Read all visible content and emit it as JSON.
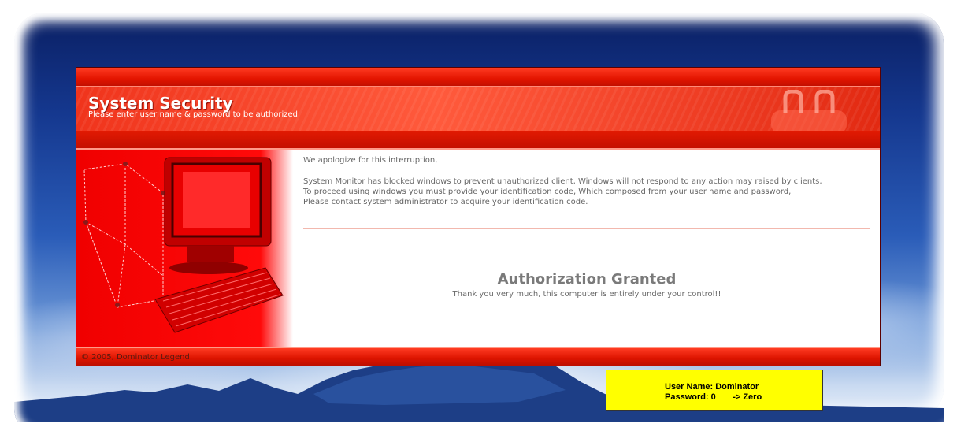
{
  "dialog": {
    "title": "System Security",
    "subtitle": "Please enter user name & password to be authorized",
    "greeting": "We apologize for this interruption,",
    "message_lines": [
      "System Monitor has blocked windows to prevent unauthorized client, Windows will not respond to any action may raised by clients,",
      "To proceed using windows you must provide your identification code, Which composed from your user name and password,",
      "Please contact system administrator to acquire your identification code."
    ],
    "status_title": "Authorization Granted",
    "status_message": "Thank you very much, this computer is entirely under your control!!",
    "footer": "© 2005, Dominator Legend"
  },
  "note": {
    "line1": "User Name: Dominator",
    "line2": "Password: 0       -> Zero"
  },
  "colors": {
    "accent_red": "#e41500",
    "note_yellow": "#ffff00"
  },
  "icons": [
    "padlock-icon",
    "computer-illustration"
  ]
}
